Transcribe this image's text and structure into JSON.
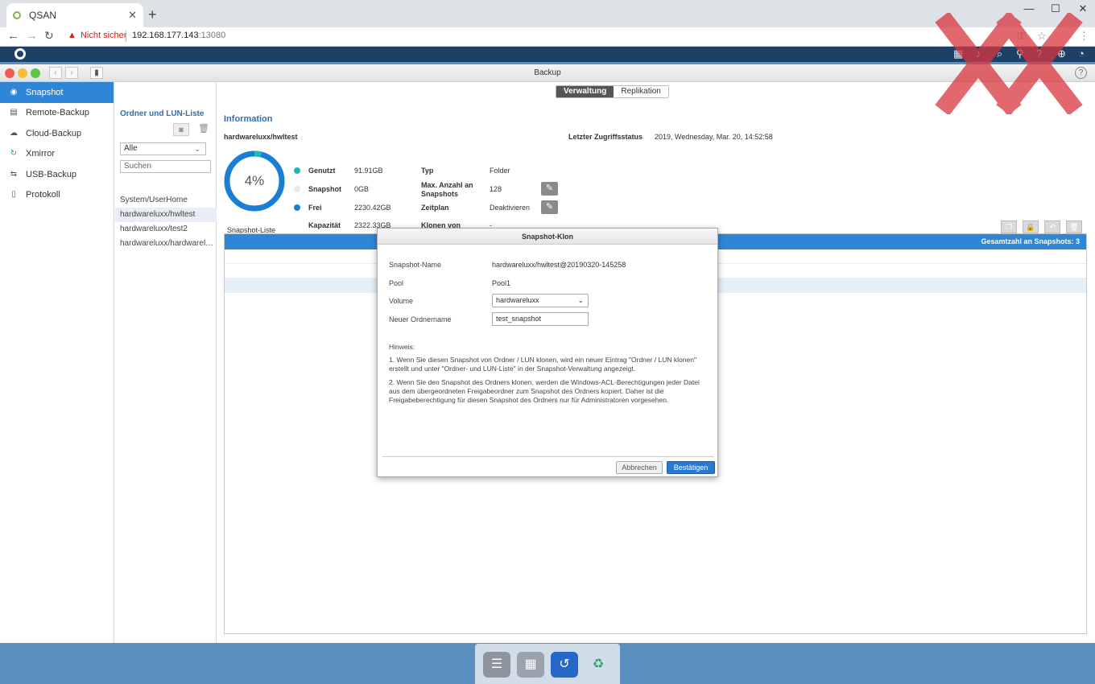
{
  "browser": {
    "tab_title": "QSAN",
    "tab_close": "✕",
    "new_tab": "+",
    "insecure_label": "Nicht sicher",
    "url_host": "192.168.177.143",
    "url_port": ":13080"
  },
  "window": {
    "title": "Backup",
    "help": "?"
  },
  "sidebar": {
    "items": [
      {
        "label": "Snapshot",
        "icon": "camera-icon"
      },
      {
        "label": "Remote-Backup",
        "icon": "server-icon"
      },
      {
        "label": "Cloud-Backup",
        "icon": "cloud-icon"
      },
      {
        "label": "Xmirror",
        "icon": "sync-icon"
      },
      {
        "label": "USB-Backup",
        "icon": "usb-icon"
      },
      {
        "label": "Protokoll",
        "icon": "log-icon"
      }
    ]
  },
  "folder_panel": {
    "title": "Ordner und LUN-Liste",
    "filter_value": "Alle",
    "search_placeholder": "Suchen",
    "items": [
      "System/UserHome",
      "hardwareluxx/hwltest",
      "hardwareluxx/test2",
      "hardwareluxx/hardwareluxx-..."
    ]
  },
  "main": {
    "tabs": [
      "Verwaltung",
      "Replikation"
    ],
    "info_title": "Information",
    "folder_name": "hardwareluxx/hwltest",
    "access_label": "Letzter Zugriffsstatus",
    "access_value": "2019, Wednesday, Mar. 20, 14:52:58",
    "usage_percent_text": "4%",
    "usage_fraction": 0.04,
    "legend": [
      {
        "label": "Genutzt",
        "value": "91.91GB",
        "color": "#26b5b5"
      },
      {
        "label": "Snapshot",
        "value": "0GB",
        "color": "#e8e8e8"
      },
      {
        "label": "Frei",
        "value": "2230.42GB",
        "color": "#1a7fd4"
      },
      {
        "label": "Kapazität",
        "value": "2322.33GB"
      }
    ],
    "props": [
      {
        "label": "Typ",
        "value": "Folder"
      },
      {
        "label": "Max. Anzahl an Snapshots",
        "value": "128"
      },
      {
        "label": "Zeitplan",
        "value": "Deaktivieren"
      },
      {
        "label": "Klonen von",
        "value": "-"
      }
    ],
    "snapshot_list_label": "Snapshot-Liste",
    "snapshot_total": "Gesamtzahl an Snapshots: 3"
  },
  "modal": {
    "title": "Snapshot-Klon",
    "fields": {
      "name_label": "Snapshot-Name",
      "name_value": "hardwareluxx/hwltest@20190320-145258",
      "pool_label": "Pool",
      "pool_value": "Pool1",
      "volume_label": "Volume",
      "volume_value": "hardwareluxx",
      "folder_label": "Neuer Ordnername",
      "folder_value": "test_snapshot"
    },
    "note_title": "Hinweis:",
    "note_1": "1. Wenn Sie diesen Snapshot von Ordner / LUN klonen, wird ein neuer Eintrag \"Ordner / LUN klonen\" erstellt und unter \"Ordner- und LUN-Liste\" in der Snapshot-Verwaltung angezeigt.",
    "note_2": "2. Wenn Sie den Snapshot des Ordners klonen, werden die Windows-ACL-Berechtigungen jeder Datei aus dem übergeordneten Freigabeordner zum Snapshot des Ordners kopiert. Daher ist die Freigabeberechtigung für diesen Snapshot des Ordners nur für Administratoren vorgesehen.",
    "cancel": "Abbrechen",
    "confirm": "Bestätigen"
  },
  "colors": {
    "accent": "#2f86d6",
    "topbar": "#1e3f66",
    "used": "#26b5b5",
    "free": "#1a7fd4"
  }
}
